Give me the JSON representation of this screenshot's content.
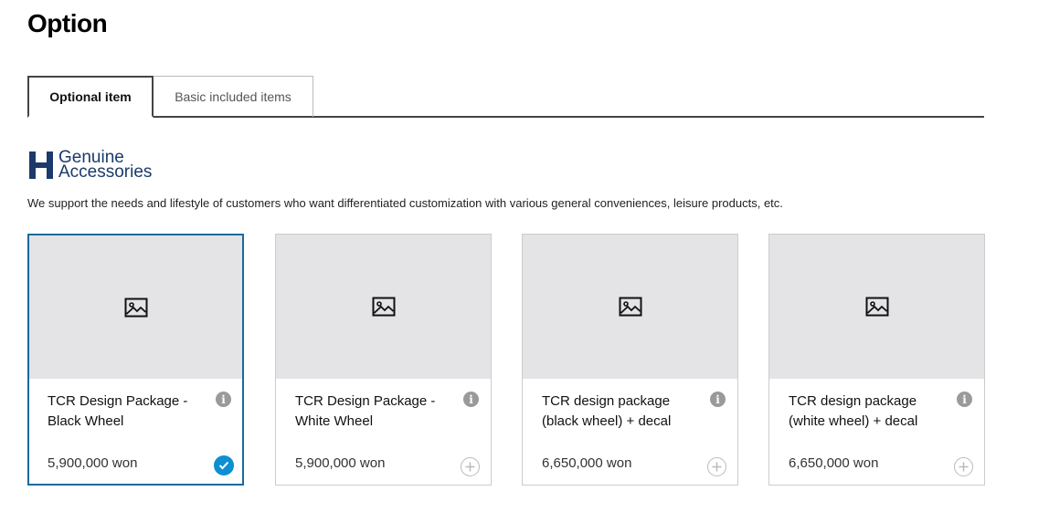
{
  "page": {
    "title": "Option"
  },
  "tabs": [
    {
      "label": "Optional item",
      "active": true
    },
    {
      "label": "Basic included items",
      "active": false
    }
  ],
  "brand": {
    "line1": "Genuine",
    "line2": "Accessories",
    "color": "#1b3a6b"
  },
  "description": "We support the needs and lifestyle of customers who want differentiated customization with various general conveniences, leisure products, etc.",
  "colors": {
    "selected_border": "#1a6aa0",
    "check_fill": "#0d8fd1",
    "thumb_bg": "#e4e3e5",
    "info_fill": "#9a9a9a"
  },
  "products": [
    {
      "name": "TCR Design Package - Black Wheel",
      "price": "5,900,000 won",
      "selected": true,
      "icon": "image-placeholder-icon"
    },
    {
      "name": "TCR Design Package - White Wheel",
      "price": "5,900,000 won",
      "selected": false,
      "icon": "image-placeholder-icon"
    },
    {
      "name": "TCR design package (black wheel) + decal",
      "price": "6,650,000 won",
      "selected": false,
      "icon": "image-placeholder-icon"
    },
    {
      "name": "TCR design package (white wheel) + decal",
      "price": "6,650,000 won",
      "selected": false,
      "icon": "image-placeholder-icon"
    }
  ]
}
